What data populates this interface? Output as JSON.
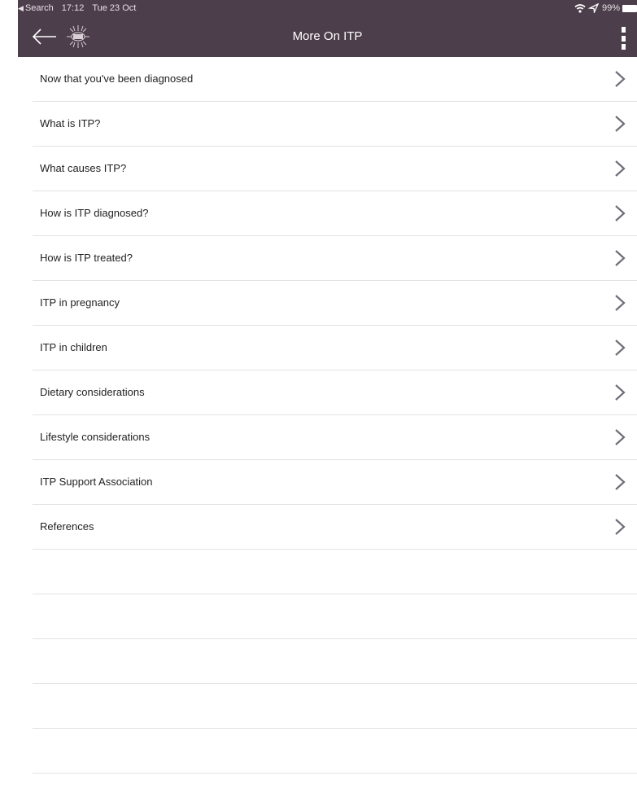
{
  "status_bar": {
    "back_app": "Search",
    "time": "17:12",
    "date": "Tue 23 Oct",
    "battery": "99%"
  },
  "nav": {
    "title": "More On ITP",
    "logo_icon": "itp-logo-icon",
    "back_icon": "arrow-left-icon",
    "menu_icon": "more-vertical-icon"
  },
  "colors": {
    "header_bg": "#4d3e4b",
    "chevron": "#6e6e78",
    "divider": "#e3e3e3"
  },
  "list": {
    "items": [
      {
        "label": "Now that you've been diagnosed"
      },
      {
        "label": "What is ITP?"
      },
      {
        "label": "What causes ITP?"
      },
      {
        "label": "How is ITP diagnosed?"
      },
      {
        "label": "How is ITP treated?"
      },
      {
        "label": "ITP in pregnancy"
      },
      {
        "label": "ITP in children"
      },
      {
        "label": "Dietary considerations"
      },
      {
        "label": "Lifestyle considerations"
      },
      {
        "label": "ITP Support Association"
      },
      {
        "label": "References"
      }
    ],
    "empty_rows": 5
  }
}
